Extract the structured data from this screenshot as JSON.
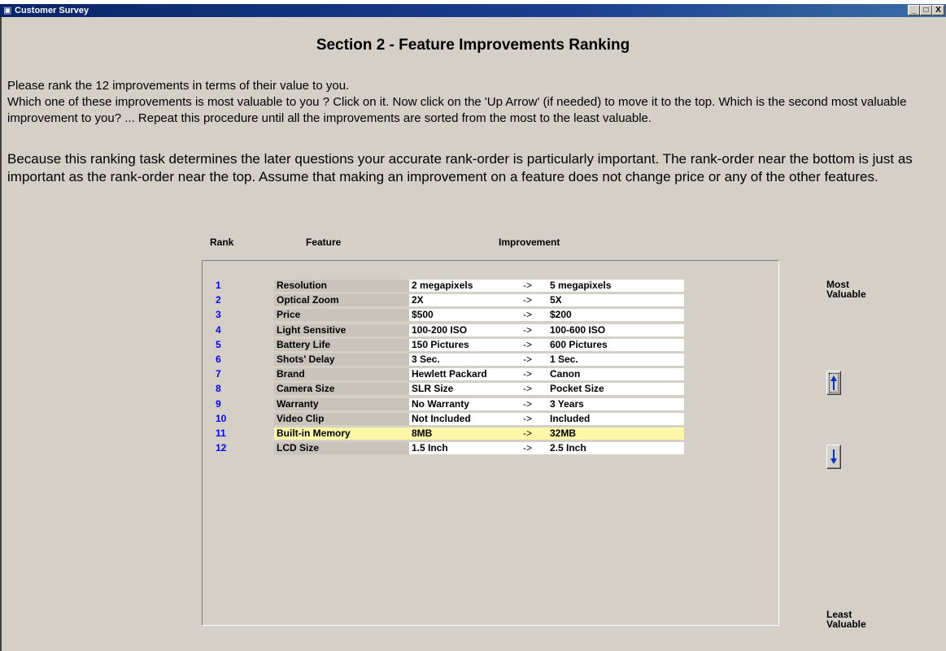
{
  "window": {
    "title": "Customer Survey",
    "min_label": "_",
    "max_label": "□",
    "close_label": "X"
  },
  "heading": "Section 2 - Feature Improvements Ranking",
  "instructions": "Please rank the 12 improvements in terms of their value to you.\nWhich one of these improvements is most valuable to you ? Click on it. Now click on the  'Up Arrow' (if needed) to  move it to the top. Which is the second most valuable improvement to you? ... Repeat this procedure until all the improvements are sorted from the most to the least valuable.",
  "emphasis": "Because this ranking task determines the later questions your accurate rank-order is particularly important. The rank-order near the bottom is just as important as the rank-order near the top. Assume that making an improvement on a feature does not change price or any of the other features.",
  "columns": {
    "rank": "Rank",
    "feature": "Feature",
    "improvement": "Improvement"
  },
  "rows": [
    {
      "rank": "1",
      "feature": "Resolution",
      "from": "2 megapixels",
      "arrow": "->",
      "to": "5 megapixels"
    },
    {
      "rank": "2",
      "feature": "Optical Zoom",
      "from": "2X",
      "arrow": "->",
      "to": "5X"
    },
    {
      "rank": "3",
      "feature": "Price",
      "from": "$500",
      "arrow": "->",
      "to": "$200"
    },
    {
      "rank": "4",
      "feature": "Light Sensitive",
      "from": "100-200 ISO",
      "arrow": "->",
      "to": "100-600 ISO"
    },
    {
      "rank": "5",
      "feature": "Battery Life",
      "from": "150 Pictures",
      "arrow": "->",
      "to": "600 Pictures"
    },
    {
      "rank": "6",
      "feature": "Shots' Delay",
      "from": "3 Sec.",
      "arrow": "->",
      "to": "1 Sec."
    },
    {
      "rank": "7",
      "feature": "Brand",
      "from": "Hewlett Packard",
      "arrow": "->",
      "to": "Canon"
    },
    {
      "rank": "8",
      "feature": "Camera Size",
      "from": "SLR Size",
      "arrow": "->",
      "to": "Pocket Size"
    },
    {
      "rank": "9",
      "feature": "Warranty",
      "from": "No Warranty",
      "arrow": "->",
      "to": "3 Years"
    },
    {
      "rank": "10",
      "feature": "Video Clip",
      "from": "Not Included",
      "arrow": "->",
      "to": "Included"
    },
    {
      "rank": "11",
      "feature": "Built-in Memory",
      "from": "8MB",
      "arrow": "->",
      "to": "32MB",
      "selected": true
    },
    {
      "rank": "12",
      "feature": "LCD Size",
      "from": "1.5 Inch",
      "arrow": "->",
      "to": "2.5 Inch"
    }
  ],
  "side": {
    "most": "Most\nValuable",
    "least": "Least\nValuable"
  },
  "colors": {
    "rank_text": "#0000ff",
    "selected_row": "#fdf7a8",
    "window_bg": "#d4d0c8",
    "arrow_icon": "#0033cc"
  },
  "icons": {
    "up": "up-arrow-icon",
    "down": "down-arrow-icon"
  }
}
